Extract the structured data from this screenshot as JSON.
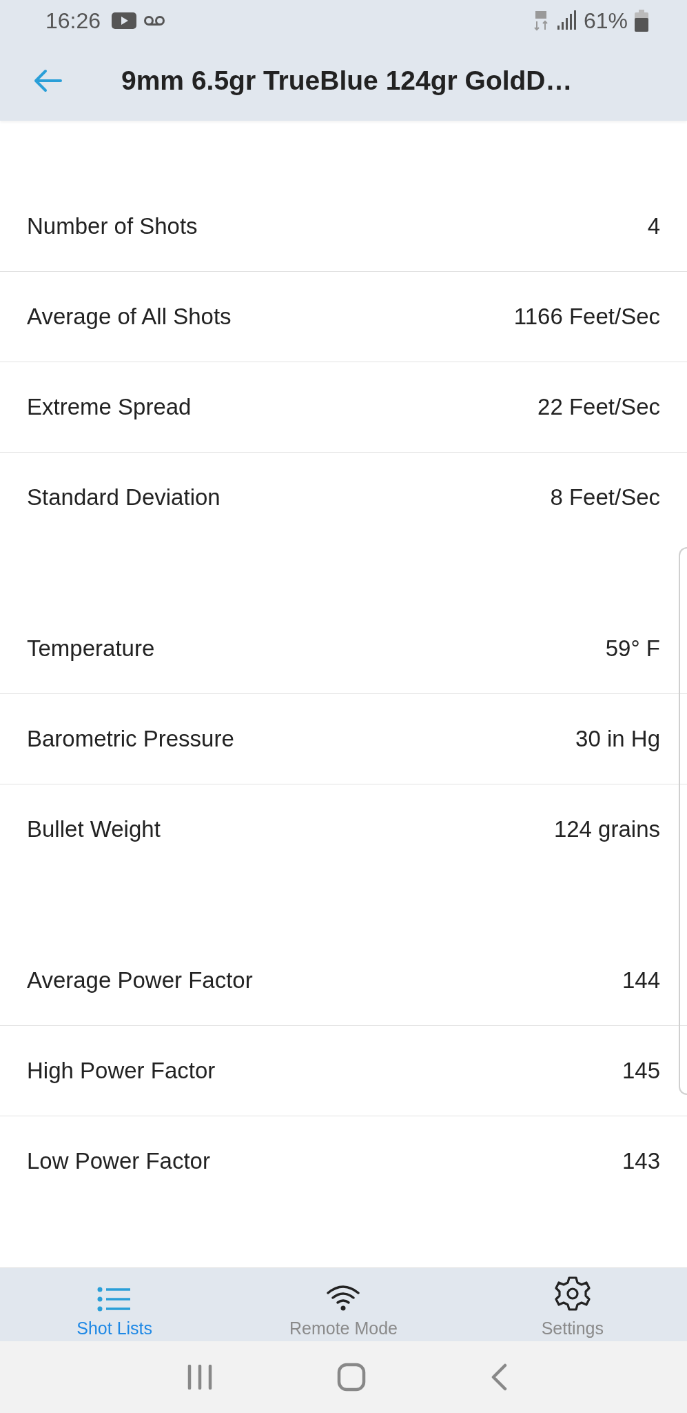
{
  "status_bar": {
    "time": "16:26",
    "battery": "61%"
  },
  "header": {
    "title": "9mm 6.5gr TrueBlue 124gr GoldD…"
  },
  "groups": [
    {
      "rows": [
        {
          "label": "Number of Shots",
          "value": "4"
        },
        {
          "label": "Average of All Shots",
          "value": "1166 Feet/Sec"
        },
        {
          "label": "Extreme Spread",
          "value": "22 Feet/Sec"
        },
        {
          "label": "Standard Deviation",
          "value": "8 Feet/Sec"
        }
      ]
    },
    {
      "rows": [
        {
          "label": "Temperature",
          "value": "59° F"
        },
        {
          "label": "Barometric Pressure",
          "value": "30 in Hg"
        },
        {
          "label": "Bullet Weight",
          "value": "124 grains"
        }
      ]
    },
    {
      "rows": [
        {
          "label": "Average Power Factor",
          "value": "144"
        },
        {
          "label": "High Power Factor",
          "value": "145"
        },
        {
          "label": "Low Power Factor",
          "value": "143"
        }
      ]
    }
  ],
  "bottom_nav": [
    {
      "kind": "list",
      "label": "Shot Lists",
      "selected": true
    },
    {
      "kind": "wifi",
      "label": "Remote Mode",
      "selected": false
    },
    {
      "kind": "gear",
      "label": "Settings",
      "selected": false
    }
  ]
}
